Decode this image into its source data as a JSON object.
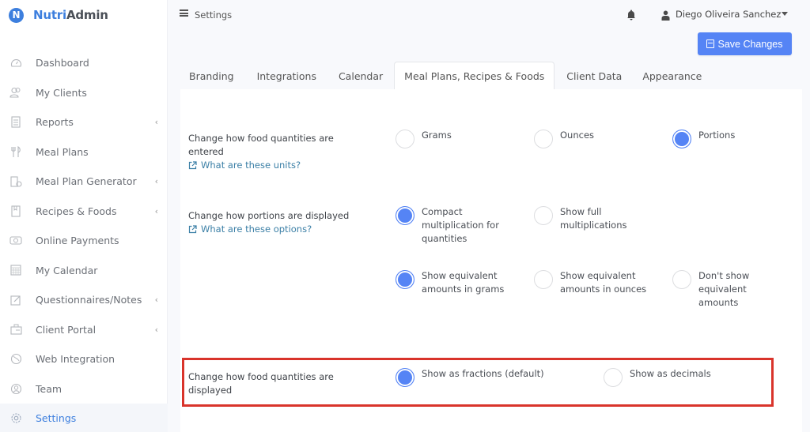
{
  "app": {
    "name_part1": "Nutri",
    "name_part2": "Admin",
    "logo_letter": "N"
  },
  "sidebar": {
    "items": [
      {
        "label": "Dashboard",
        "icon": "dashboard-icon",
        "has_submenu": false,
        "active": false
      },
      {
        "label": "My Clients",
        "icon": "clients-icon",
        "has_submenu": false,
        "active": false
      },
      {
        "label": "Reports",
        "icon": "reports-icon",
        "has_submenu": true,
        "active": false
      },
      {
        "label": "Meal Plans",
        "icon": "fork-knife-icon",
        "has_submenu": false,
        "active": false
      },
      {
        "label": "Meal Plan Generator",
        "icon": "generator-icon",
        "has_submenu": true,
        "active": false
      },
      {
        "label": "Recipes & Foods",
        "icon": "book-icon",
        "has_submenu": true,
        "active": false
      },
      {
        "label": "Online Payments",
        "icon": "money-icon",
        "has_submenu": false,
        "active": false
      },
      {
        "label": "My Calendar",
        "icon": "calendar-icon",
        "has_submenu": false,
        "active": false
      },
      {
        "label": "Questionnaires/Notes",
        "icon": "edit-icon",
        "has_submenu": true,
        "active": false
      },
      {
        "label": "Client Portal",
        "icon": "portal-icon",
        "has_submenu": true,
        "active": false
      },
      {
        "label": "Web Integration",
        "icon": "globe-icon",
        "has_submenu": false,
        "active": false
      },
      {
        "label": "Team",
        "icon": "team-icon",
        "has_submenu": false,
        "active": false
      },
      {
        "label": "Settings",
        "icon": "gear-icon",
        "has_submenu": false,
        "active": true
      }
    ],
    "chevron": "‹"
  },
  "topbar": {
    "breadcrumb": "Settings",
    "user_name": "Diego Oliveira Sanchez"
  },
  "toolbar": {
    "save_label": "Save Changes"
  },
  "tabs": [
    {
      "label": "Branding",
      "active": false
    },
    {
      "label": "Integrations",
      "active": false
    },
    {
      "label": "Calendar",
      "active": false
    },
    {
      "label": "Meal Plans, Recipes & Foods",
      "active": true
    },
    {
      "label": "Client Data",
      "active": false
    },
    {
      "label": "Appearance",
      "active": false
    }
  ],
  "settings": {
    "food_entry": {
      "label": "Change how food quantities are entered",
      "help_link": "What are these units?",
      "options": [
        {
          "label": "Grams",
          "checked": false
        },
        {
          "label": "Ounces",
          "checked": false
        },
        {
          "label": "Portions",
          "checked": true
        }
      ]
    },
    "portions_display": {
      "label": "Change how portions are displayed",
      "help_link": "What are these options?",
      "options_multiplication": [
        {
          "label": "Compact multiplication for quantities",
          "checked": true
        },
        {
          "label": "Show full multiplications",
          "checked": false
        }
      ],
      "options_equivalent": [
        {
          "label": "Show equivalent amounts in grams",
          "checked": true
        },
        {
          "label": "Show equivalent amounts in ounces",
          "checked": false
        },
        {
          "label": "Don't show equivalent amounts",
          "checked": false
        }
      ]
    },
    "quantity_display": {
      "label": "Change how food quantities are displayed",
      "options": [
        {
          "label": "Show as fractions (default)",
          "checked": true
        },
        {
          "label": "Show as decimals",
          "checked": false
        }
      ]
    }
  },
  "colors": {
    "accent": "#5584f5",
    "brand": "#3d7fde",
    "link": "#3b7fa6",
    "highlight_border": "#d9342b"
  }
}
